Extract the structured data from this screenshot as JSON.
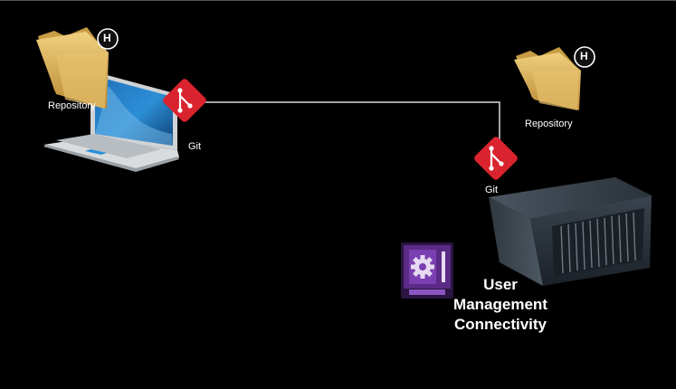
{
  "left_node": {
    "repository_label": "Repository",
    "badge_letter": "H",
    "git_label": "Git"
  },
  "right_node": {
    "repository_label": "Repository",
    "badge_letter": "H",
    "git_label": "Git"
  },
  "caption": {
    "line1": "User",
    "line2": "Management",
    "line3": "Connectivity"
  },
  "icons": {
    "folder": "folder-icon",
    "laptop": "laptop-icon",
    "git": "git-diamond-icon",
    "server": "server-rack-icon",
    "settings": "settings-panel-icon"
  },
  "colors": {
    "background": "#000000",
    "git_red": "#d9232e",
    "folder": "#d8b15a",
    "settings_purple": "#5b2a86",
    "connector": "#d9d9d9"
  }
}
